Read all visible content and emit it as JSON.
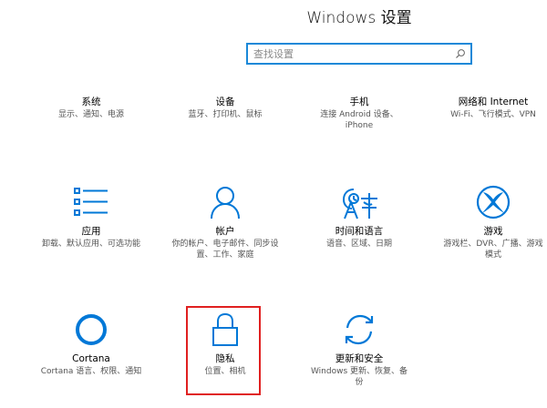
{
  "window": {
    "title": "Windows 设置"
  },
  "search": {
    "placeholder": "查找设置",
    "value": ""
  },
  "tiles": [
    {
      "id": "system",
      "name": "系统",
      "desc": "显示、通知、电源"
    },
    {
      "id": "devices",
      "name": "设备",
      "desc": "蓝牙、打印机、鼠标"
    },
    {
      "id": "phone",
      "name": "手机",
      "desc": "连接 Android 设备、iPhone"
    },
    {
      "id": "network",
      "name": "网络和 Internet",
      "desc": "Wi-Fi、飞行模式、VPN"
    },
    {
      "id": "apps",
      "name": "应用",
      "desc": "卸载、默认应用、可选功能"
    },
    {
      "id": "accounts",
      "name": "帐户",
      "desc": "你的帐户、电子邮件、同步设置、工作、家庭"
    },
    {
      "id": "time",
      "name": "时间和语言",
      "desc": "语音、区域、日期"
    },
    {
      "id": "gaming",
      "name": "游戏",
      "desc": "游戏栏、DVR、广播、游戏模式"
    },
    {
      "id": "cortana",
      "name": "Cortana",
      "desc": "Cortana 语言、权限、通知"
    },
    {
      "id": "privacy",
      "name": "隐私",
      "desc": "位置、相机"
    },
    {
      "id": "update",
      "name": "更新和安全",
      "desc": "Windows 更新、恢复、备份"
    }
  ],
  "icons": {
    "apps": "apps-list-icon",
    "accounts": "person-icon",
    "time": "language-icon",
    "gaming": "xbox-icon",
    "cortana": "cortana-circle-icon",
    "privacy": "lock-icon",
    "update": "sync-icon",
    "search": "search-icon"
  },
  "colors": {
    "accent": "#0078d7",
    "highlight": "#e02020"
  }
}
